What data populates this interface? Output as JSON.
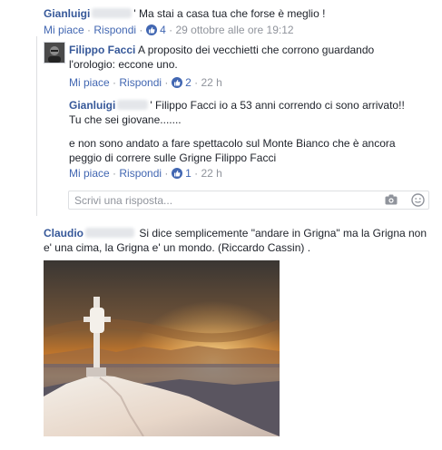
{
  "comments": [
    {
      "author": "Gianluigi",
      "text": "' Ma stai a casa tua che forse è meglio !",
      "actions": {
        "like": "Mi piace",
        "reply": "Rispondi",
        "reactions": "4",
        "time": "29 ottobre alle ore 19:12"
      }
    },
    {
      "author": "Filippo Facci",
      "text_line1": "A proposito dei vecchietti che corrono guardando",
      "text_line2": "l'orologio: eccone uno.",
      "actions": {
        "like": "Mi piace",
        "reply": "Rispondi",
        "reactions": "2",
        "time": "22 h"
      }
    },
    {
      "author": "Gianluigi",
      "text_line1": "' Filippo Facci io a 53 anni correndo ci sono arrivato!!",
      "text_line2": "Tu che sei giovane.......",
      "text_line3": "e non sono andato a fare spettacolo sul Monte Bianco che è ancora",
      "text_line4": "peggio di correre sulle Grigne Filippo Facci",
      "actions": {
        "like": "Mi piace",
        "reply": "Rispondi",
        "reactions": "1",
        "time": "22 h"
      }
    },
    {
      "author": "Claudio",
      "text_line1": "Si dice semplicemente \"andare in Grigna\" ma la Grigna non",
      "text_line2": "e' una cima, la Grigna e' un mondo. (Riccardo Cassin) ."
    }
  ],
  "reply_box": {
    "placeholder": "Scrivi una risposta..."
  },
  "separator": "·",
  "icons": {
    "camera": "camera-icon",
    "emoji": "emoji-icon",
    "like": "like-thumb-icon"
  },
  "colors": {
    "link": "#365899",
    "action": "#4267b2",
    "meta": "#90949c",
    "badge": "#4267b2"
  }
}
